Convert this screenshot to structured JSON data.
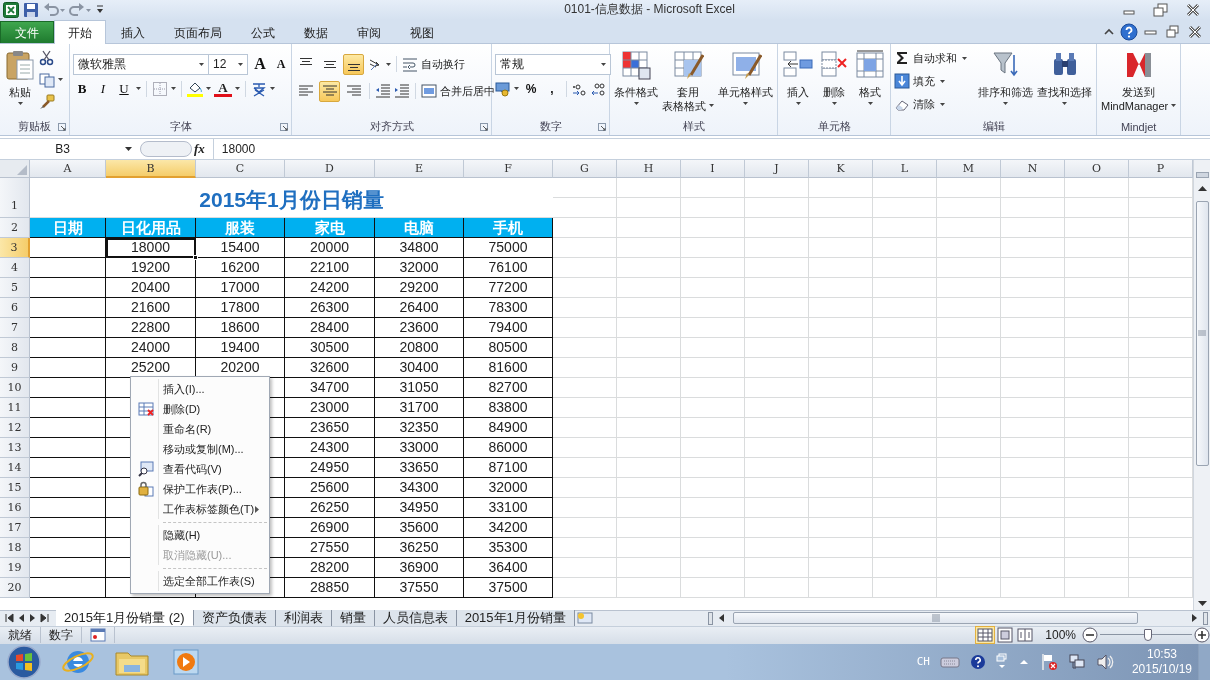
{
  "window": {
    "title": "0101-信息数据 - Microsoft Excel"
  },
  "ribbon_tabs": [
    {
      "label": "文件",
      "kind": "file",
      "selected": false
    },
    {
      "label": "开始",
      "kind": "tab",
      "selected": true
    },
    {
      "label": "插入",
      "kind": "tab",
      "selected": false
    },
    {
      "label": "页面布局",
      "kind": "tab",
      "selected": false
    },
    {
      "label": "公式",
      "kind": "tab",
      "selected": false
    },
    {
      "label": "数据",
      "kind": "tab",
      "selected": false
    },
    {
      "label": "审阅",
      "kind": "tab",
      "selected": false
    },
    {
      "label": "视图",
      "kind": "tab",
      "selected": false
    }
  ],
  "ribbon_groups": [
    {
      "kind": "clipboard",
      "label": "剪贴板",
      "paste": "粘贴"
    },
    {
      "kind": "font",
      "label": "字体",
      "font": "微软雅黑",
      "size": "12",
      "grow": "A",
      "shrink": "A",
      "bold": "B",
      "italic": "I",
      "underline": "U",
      "font_color": "A"
    },
    {
      "kind": "alignment",
      "label": "对齐方式",
      "vertical": [
        {
          "selected": false
        },
        {
          "selected": false
        },
        {
          "selected": true
        }
      ],
      "horizontal": [
        {
          "selected": false
        },
        {
          "selected": true
        },
        {
          "selected": false
        }
      ],
      "wrap": "自动换行",
      "merge": "合并后居中"
    },
    {
      "kind": "number",
      "label": "数字",
      "format": "常规",
      "percent": "%",
      "comma": ","
    },
    {
      "kind": "large",
      "label": "样式",
      "buttons": [
        {
          "lines": [
            "条件格式"
          ]
        },
        {
          "lines": [
            "套用",
            "表格格式"
          ]
        },
        {
          "lines": [
            "单元格样式"
          ]
        }
      ]
    },
    {
      "kind": "large",
      "label": "单元格",
      "buttons": [
        {
          "lines": [
            "插入"
          ]
        },
        {
          "lines": [
            "删除"
          ]
        },
        {
          "lines": [
            "格式"
          ]
        }
      ]
    },
    {
      "kind": "editing",
      "label": "编辑",
      "small": [
        "自动求和",
        "填充",
        "清除"
      ],
      "buttons": [
        {
          "lines": [
            "排序和筛选"
          ]
        },
        {
          "lines": [
            "查找和选择"
          ]
        }
      ]
    },
    {
      "kind": "large",
      "label": "Mindjet",
      "buttons": [
        {
          "lines": [
            "发送到",
            "MindManager"
          ]
        }
      ]
    }
  ],
  "formula_bar": {
    "name_box": "B3",
    "fx": "fx",
    "value": "18000"
  },
  "sheet": {
    "columns": [
      {
        "label": "A",
        "selected": false
      },
      {
        "label": "B",
        "selected": true
      },
      {
        "label": "C",
        "selected": false
      },
      {
        "label": "D",
        "selected": false
      },
      {
        "label": "E",
        "selected": false
      },
      {
        "label": "F",
        "selected": false
      },
      {
        "label": "G",
        "selected": false
      },
      {
        "label": "H",
        "selected": false
      },
      {
        "label": "I",
        "selected": false
      },
      {
        "label": "J",
        "selected": false
      },
      {
        "label": "K",
        "selected": false
      },
      {
        "label": "L",
        "selected": false
      },
      {
        "label": "M",
        "selected": false
      },
      {
        "label": "N",
        "selected": false
      },
      {
        "label": "O",
        "selected": false
      },
      {
        "label": "P",
        "selected": false
      }
    ],
    "title": "2015年1月份日销量",
    "headers": [
      "日期",
      "日化用品",
      "服装",
      "家电",
      "电脑",
      "手机"
    ],
    "rows": [
      {
        "label": "1",
        "selected": false
      },
      {
        "label": "2",
        "selected": false
      },
      {
        "label": "3",
        "selected": true,
        "values": [
          "18000",
          "15400",
          "20000",
          "34800",
          "75000"
        ]
      },
      {
        "label": "4",
        "selected": false,
        "values": [
          "19200",
          "16200",
          "22100",
          "32000",
          "76100"
        ]
      },
      {
        "label": "5",
        "selected": false,
        "values": [
          "20400",
          "17000",
          "24200",
          "29200",
          "77200"
        ]
      },
      {
        "label": "6",
        "selected": false,
        "values": [
          "21600",
          "17800",
          "26300",
          "26400",
          "78300"
        ]
      },
      {
        "label": "7",
        "selected": false,
        "values": [
          "22800",
          "18600",
          "28400",
          "23600",
          "79400"
        ]
      },
      {
        "label": "8",
        "selected": false,
        "values": [
          "24000",
          "19400",
          "30500",
          "20800",
          "80500"
        ]
      },
      {
        "label": "9",
        "selected": false,
        "values": [
          "25200",
          "20200",
          "32600",
          "30400",
          "81600"
        ]
      },
      {
        "label": "10",
        "selected": false,
        "values": [
          "34700",
          "31050",
          "82700"
        ]
      },
      {
        "label": "11",
        "selected": false,
        "values": [
          "23000",
          "31700",
          "83800"
        ]
      },
      {
        "label": "12",
        "selected": false,
        "values": [
          "23650",
          "32350",
          "84900"
        ]
      },
      {
        "label": "13",
        "selected": false,
        "values": [
          "24300",
          "33000",
          "86000"
        ]
      },
      {
        "label": "14",
        "selected": false,
        "values": [
          "24950",
          "33650",
          "87100"
        ]
      },
      {
        "label": "15",
        "selected": false,
        "values": [
          "25600",
          "34300",
          "32000"
        ]
      },
      {
        "label": "16",
        "selected": false,
        "values": [
          "26250",
          "34950",
          "33100"
        ]
      },
      {
        "label": "17",
        "selected": false,
        "values": [
          "26900",
          "35600",
          "34200"
        ]
      },
      {
        "label": "18",
        "selected": false,
        "values": [
          "27550",
          "36250",
          "35300"
        ]
      },
      {
        "label": "19",
        "selected": false,
        "values": [
          "28200",
          "36900",
          "36400"
        ]
      },
      {
        "label": "20",
        "selected": false,
        "values": [
          "28850",
          "37550",
          "37500"
        ]
      }
    ]
  },
  "context_menu": [
    {
      "kind": "item",
      "label": "插入(I)...",
      "disabled": false
    },
    {
      "kind": "item",
      "label": "删除(D)",
      "disabled": false
    },
    {
      "kind": "item",
      "label": "重命名(R)",
      "disabled": false
    },
    {
      "kind": "item",
      "label": "移动或复制(M)...",
      "disabled": false
    },
    {
      "kind": "item",
      "label": "查看代码(V)",
      "disabled": false
    },
    {
      "kind": "item",
      "label": "保护工作表(P)...",
      "disabled": false
    },
    {
      "kind": "submenu",
      "label": "工作表标签颜色(T)",
      "disabled": false
    },
    {
      "kind": "separator"
    },
    {
      "kind": "item",
      "label": "隐藏(H)",
      "disabled": false
    },
    {
      "kind": "item",
      "label": "取消隐藏(U)...",
      "disabled": true
    },
    {
      "kind": "separator"
    },
    {
      "kind": "item",
      "label": "选定全部工作表(S)",
      "disabled": false
    }
  ],
  "sheet_tabs": [
    {
      "label": "2015年1月份销量 (2)",
      "selected": true
    },
    {
      "label": "资产负债表",
      "selected": false
    },
    {
      "label": "利润表",
      "selected": false
    },
    {
      "label": "销量",
      "selected": false
    },
    {
      "label": "人员信息表",
      "selected": false
    },
    {
      "label": "2015年1月份销量",
      "selected": false
    }
  ],
  "status_bar": {
    "mode": "就绪",
    "num": "数字",
    "views": [
      {
        "selected": true
      },
      {
        "selected": false
      },
      {
        "selected": false
      }
    ],
    "zoom": "100%",
    "zoom_level": {
      "level": 0.52
    }
  },
  "taskbar": {
    "language": "CH",
    "time": "10:53",
    "date": "2015/10/19"
  }
}
